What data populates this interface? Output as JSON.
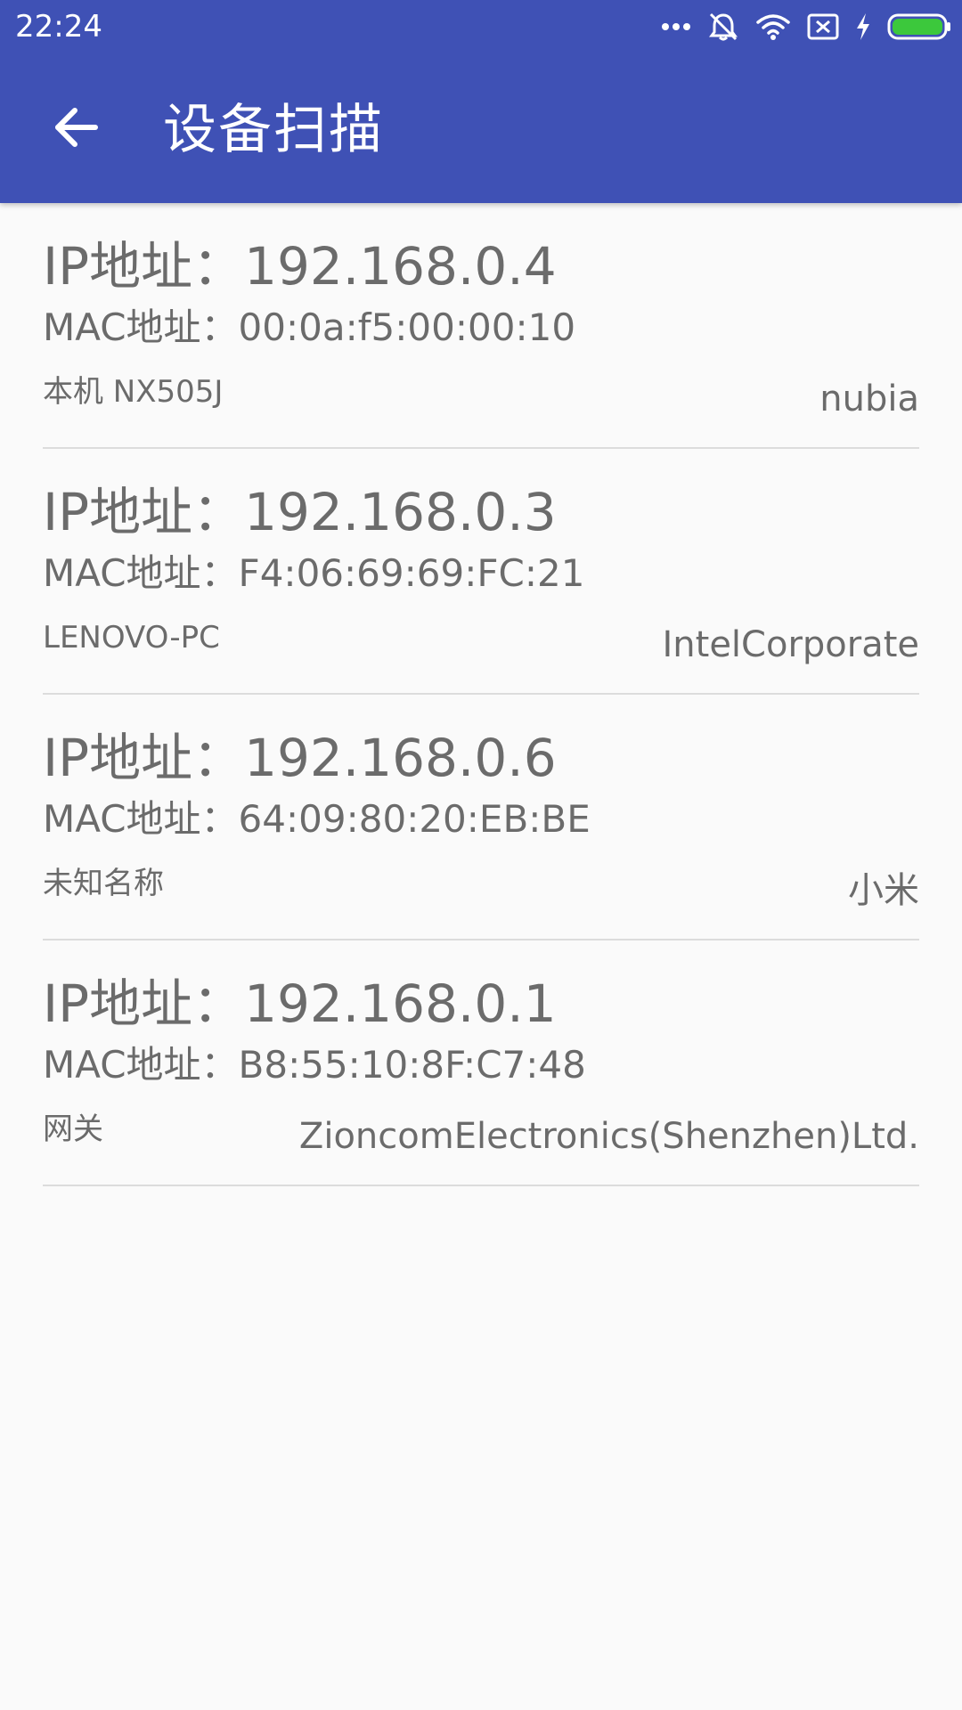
{
  "status_bar": {
    "time": "22:24",
    "icons": [
      "more-dots-icon",
      "alarm-off-icon",
      "wifi-icon",
      "sim-off-icon",
      "charging-icon",
      "battery-icon"
    ],
    "battery_color": "#3cc83c"
  },
  "app_bar": {
    "title": "设备扫描",
    "back_icon": "arrow-left-icon",
    "background": "#3f51b5"
  },
  "devices": [
    {
      "ip": "IP地址：192.168.0.4",
      "mac": "MAC地址：00:0a:f5:00:00:10",
      "name": "本机 NX505J",
      "vendor": "nubia"
    },
    {
      "ip": "IP地址：192.168.0.3",
      "mac": "MAC地址：F4:06:69:69:FC:21",
      "name": "LENOVO-PC",
      "vendor": "IntelCorporate"
    },
    {
      "ip": "IP地址：192.168.0.6",
      "mac": "MAC地址：64:09:80:20:EB:BE",
      "name": "未知名称",
      "vendor": "小米"
    },
    {
      "ip": "IP地址：192.168.0.1",
      "mac": "MAC地址：B8:55:10:8F:C7:48",
      "name": "网关",
      "vendor": "ZioncomElectronics(Shenzhen)Ltd."
    }
  ]
}
